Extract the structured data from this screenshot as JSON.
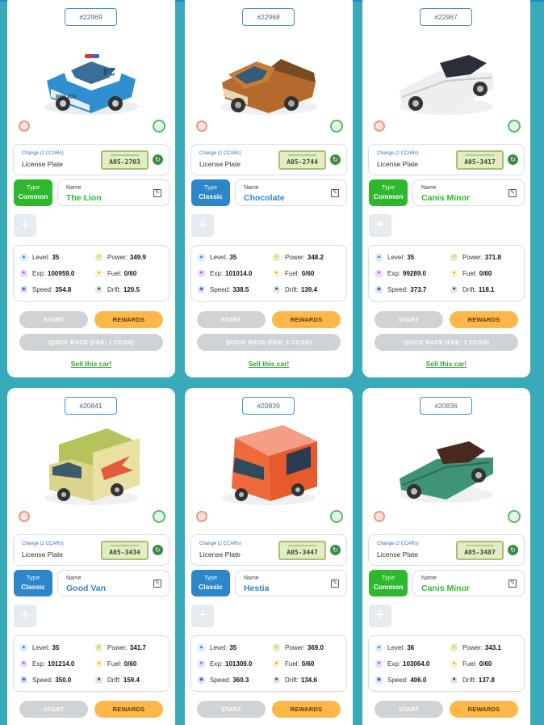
{
  "labels": {
    "change": "Change (2 CCARs)",
    "license_plate": "License Plate",
    "type": "Type",
    "name": "Name",
    "level": "Level:",
    "power": "Power:",
    "exp": "Exp:",
    "fuel": "Fuel:",
    "speed": "Speed:",
    "drift": "Drift:",
    "start": "START",
    "rewards": "REWARDS",
    "quick_race": "QUICK RACE (FEE: 1 CCAR)",
    "sell": "Sell this car!",
    "add": "+"
  },
  "colors": {
    "background": "#38aab9",
    "common": "#2db82d",
    "classic": "#2c86c9",
    "rewards": "#ffb74a",
    "disabled": "#cfd3d6"
  },
  "cars": [
    {
      "id": "#22969",
      "image": "police-suv",
      "plate": "A05-2703",
      "type": "Common",
      "name": "The Lion",
      "level": "35",
      "power": "349.9",
      "exp": "100959.0",
      "fuel": "0/60",
      "speed": "354.8",
      "drift": "120.5"
    },
    {
      "id": "#22968",
      "image": "pickup-truck",
      "plate": "A05-2744",
      "type": "Classic",
      "name": "Chocolate",
      "level": "35",
      "power": "348.2",
      "exp": "101014.0",
      "fuel": "0/60",
      "speed": "338.5",
      "drift": "139.4"
    },
    {
      "id": "#22967",
      "image": "white-sports-car",
      "plate": "A05-3417",
      "type": "Common",
      "name": "Canis Minor",
      "level": "35",
      "power": "371.8",
      "exp": "99289.0",
      "fuel": "0/60",
      "speed": "373.7",
      "drift": "118.1"
    },
    {
      "id": "#20841",
      "image": "green-van",
      "plate": "A05-3434",
      "type": "Classic",
      "name": "Good Van",
      "level": "35",
      "power": "341.7",
      "exp": "101214.0",
      "fuel": "0/60",
      "speed": "350.0",
      "drift": "159.4"
    },
    {
      "id": "#20839",
      "image": "red-food-truck",
      "plate": "A05-3447",
      "type": "Classic",
      "name": "Hestia",
      "level": "35",
      "power": "369.0",
      "exp": "101309.0",
      "fuel": "0/60",
      "speed": "360.3",
      "drift": "134.6"
    },
    {
      "id": "#20836",
      "image": "green-sports-car",
      "plate": "A05-3487",
      "type": "Common",
      "name": "Canis Minor",
      "level": "36",
      "power": "343.1",
      "exp": "103064.0",
      "fuel": "0/60",
      "speed": "406.0",
      "drift": "137.8"
    }
  ]
}
